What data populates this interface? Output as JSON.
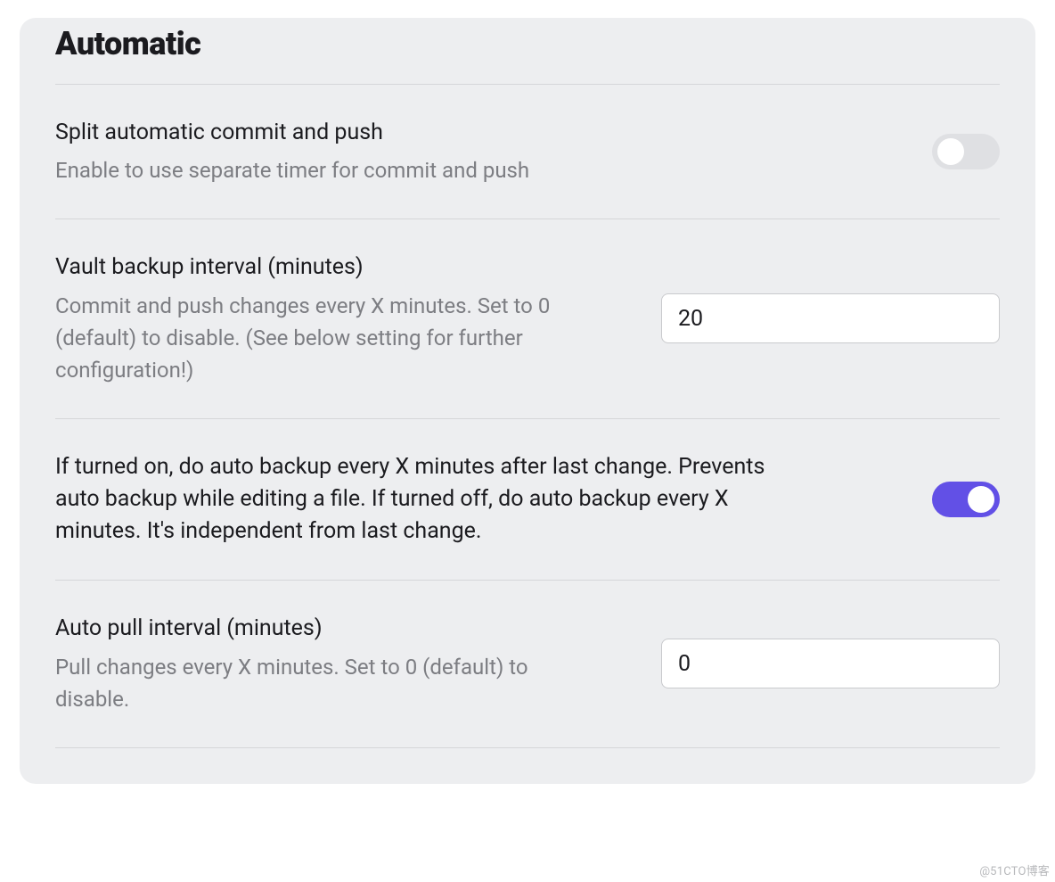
{
  "section": {
    "heading": "Automatic"
  },
  "settings": {
    "splitCommitPush": {
      "title": "Split automatic commit and push",
      "desc": "Enable to use separate timer for commit and push",
      "enabled": false
    },
    "backupInterval": {
      "title": "Vault backup interval (minutes)",
      "desc": "Commit and push changes every X minutes. Set to 0 (default) to disable. (See below setting for further configuration!)",
      "value": "20"
    },
    "backupAfterChange": {
      "title": "If turned on, do auto backup every X minutes after last change. Prevents auto backup while editing a file. If turned off, do auto backup every X minutes. It's independent from last change.",
      "enabled": true
    },
    "autoPullInterval": {
      "title": "Auto pull interval (minutes)",
      "desc": "Pull changes every X minutes. Set to 0 (default) to disable.",
      "value": "0"
    }
  },
  "watermark": "@51CTO博客"
}
